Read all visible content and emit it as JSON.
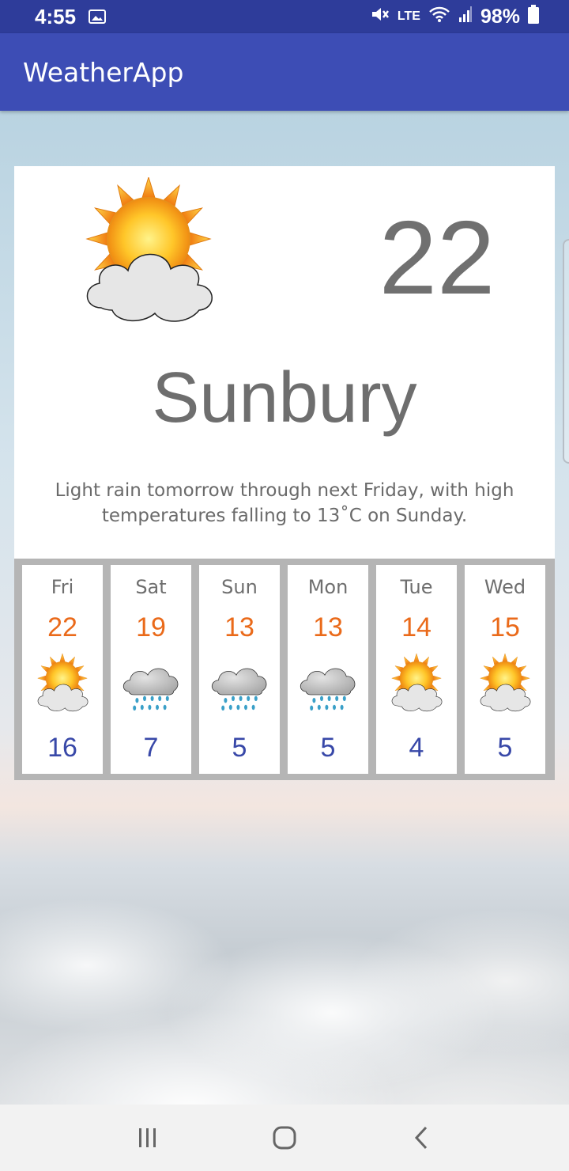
{
  "status_bar": {
    "time": "4:55",
    "lte_label": "LTE",
    "battery": "98%",
    "icons": [
      "image-icon",
      "mute-icon",
      "volte-icon",
      "wifi-icon",
      "signal-icon",
      "battery-icon"
    ]
  },
  "app": {
    "title": "WeatherApp"
  },
  "current": {
    "temperature": "22",
    "city": "Sunbury",
    "summary": "Light rain tomorrow through next Friday, with high temperatures falling to 13˚C on Sunday.",
    "icon": "partly-cloudy-icon"
  },
  "forecast": [
    {
      "day": "Fri",
      "high": "22",
      "low": "16",
      "icon": "partly-cloudy-icon"
    },
    {
      "day": "Sat",
      "high": "19",
      "low": "7",
      "icon": "rain-icon"
    },
    {
      "day": "Sun",
      "high": "13",
      "low": "5",
      "icon": "rain-icon"
    },
    {
      "day": "Mon",
      "high": "13",
      "low": "5",
      "icon": "rain-icon"
    },
    {
      "day": "Tue",
      "high": "14",
      "low": "4",
      "icon": "partly-cloudy-icon"
    },
    {
      "day": "Wed",
      "high": "15",
      "low": "5",
      "icon": "partly-cloudy-icon"
    }
  ],
  "colors": {
    "app_bar": "#3d4db5",
    "status_bar": "#2e3c9a",
    "high_temp": "#ea6a1a",
    "low_temp": "#3848a8"
  },
  "nav_bar": {
    "icons": [
      "recents-icon",
      "home-icon",
      "back-icon"
    ]
  }
}
